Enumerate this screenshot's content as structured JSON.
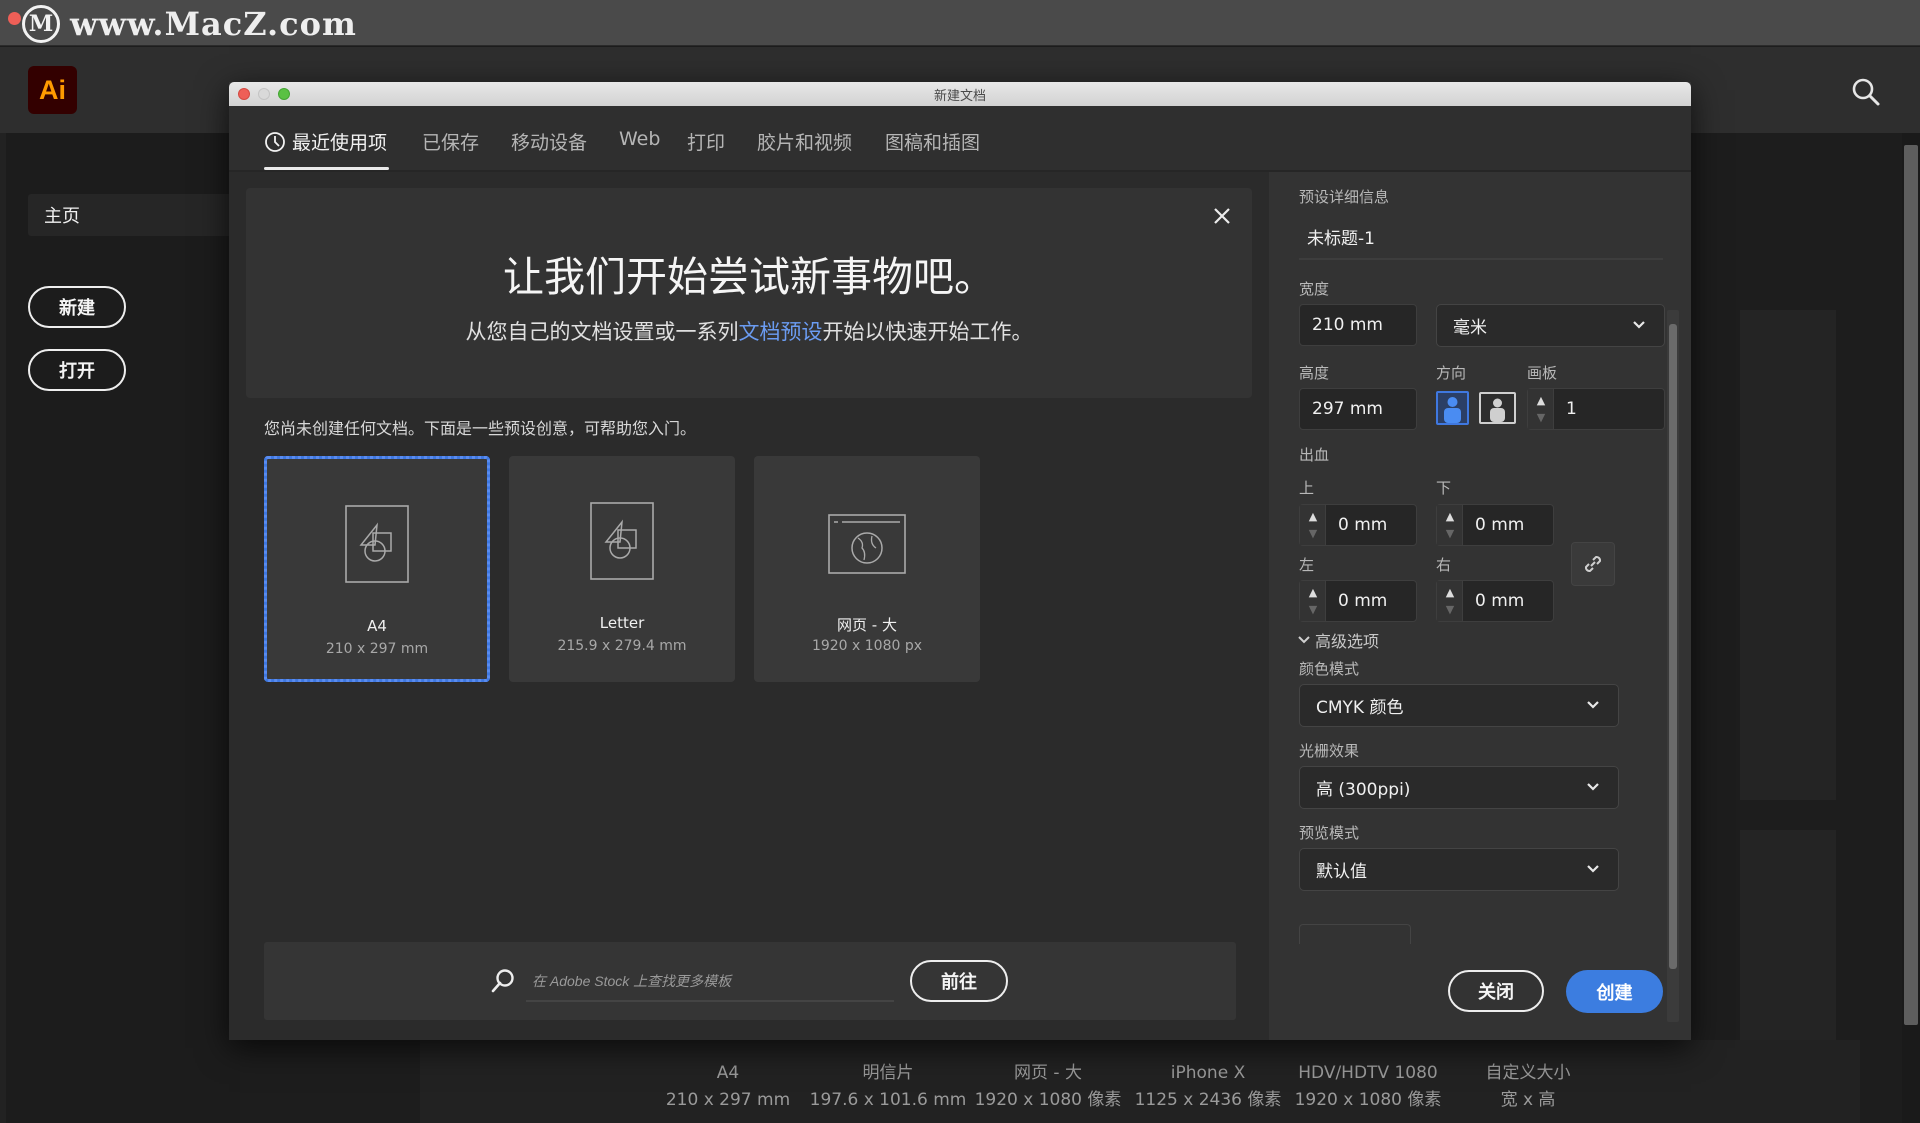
{
  "watermark": {
    "logo_letter": "M",
    "text": "www.MacZ.com"
  },
  "app": {
    "logo": "Ai",
    "search_icon": "search-icon",
    "sidebar": {
      "home_label": "主页",
      "new_button": "新建",
      "open_button": "打开"
    },
    "background_presets": [
      {
        "name": "A4",
        "size": "210 x 297 mm"
      },
      {
        "name": "明信片",
        "size": "197.6 x 101.6 mm"
      },
      {
        "name": "网页 - 大",
        "size": "1920 x 1080 像素"
      },
      {
        "name": "iPhone X",
        "size": "1125 x 2436 像素"
      },
      {
        "name": "HDV/HDTV 1080",
        "size": "1920 x 1080 像素"
      },
      {
        "name": "自定义大小",
        "size": "宽 x 高"
      }
    ]
  },
  "dialog": {
    "title": "新建文档",
    "tabs": [
      {
        "label": "最近使用项",
        "icon": "clock-icon",
        "active": true
      },
      {
        "label": "已保存",
        "active": false
      },
      {
        "label": "移动设备",
        "active": false
      },
      {
        "label": "Web",
        "active": false
      },
      {
        "label": "打印",
        "active": false
      },
      {
        "label": "胶片和视频",
        "active": false
      },
      {
        "label": "图稿和插图",
        "active": false
      }
    ],
    "hero": {
      "title": "让我们开始尝试新事物吧。",
      "subtitle_before": "从您自己的文档设置或一系列",
      "subtitle_link": "文档预设",
      "subtitle_after": "开始以快速开始工作。"
    },
    "hint": "您尚未创建任何文档。下面是一些预设创意，可帮助您入门。",
    "presets": [
      {
        "name": "A4",
        "size": "210 x 297 mm",
        "icon": "document-shapes-icon",
        "selected": true
      },
      {
        "name": "Letter",
        "size": "215.9 x 279.4 mm",
        "icon": "document-shapes-icon",
        "selected": false
      },
      {
        "name": "网页 - 大",
        "size": "1920 x 1080 px",
        "icon": "web-globe-icon",
        "selected": false
      }
    ],
    "stock": {
      "placeholder": "在 Adobe Stock 上查找更多模板",
      "go_button": "前往"
    },
    "details": {
      "section_title": "预设详细信息",
      "name_value": "未标题-1",
      "width_label": "宽度",
      "width_value": "210 mm",
      "unit_value": "毫米",
      "height_label": "高度",
      "height_value": "297 mm",
      "orientation_label": "方向",
      "orientation_selected": "portrait",
      "artboards_label": "画板",
      "artboards_value": "1",
      "bleed_label": "出血",
      "bleed_top_label": "上",
      "bleed_top_value": "0 mm",
      "bleed_bottom_label": "下",
      "bleed_bottom_value": "0 mm",
      "bleed_left_label": "左",
      "bleed_left_value": "0 mm",
      "bleed_right_label": "右",
      "bleed_right_value": "0 mm",
      "advanced_label": "高级选项",
      "color_mode_label": "颜色模式",
      "color_mode_value": "CMYK 颜色",
      "raster_label": "光栅效果",
      "raster_value": "高 (300ppi)",
      "preview_label": "预览模式",
      "preview_value": "默认值"
    },
    "close_button": "关闭",
    "create_button": "创建"
  },
  "colors": {
    "accent": "#3c7de0",
    "link": "#6b9cf2",
    "ai_logo_bg": "#330000",
    "ai_logo_fg": "#ff9a00"
  }
}
